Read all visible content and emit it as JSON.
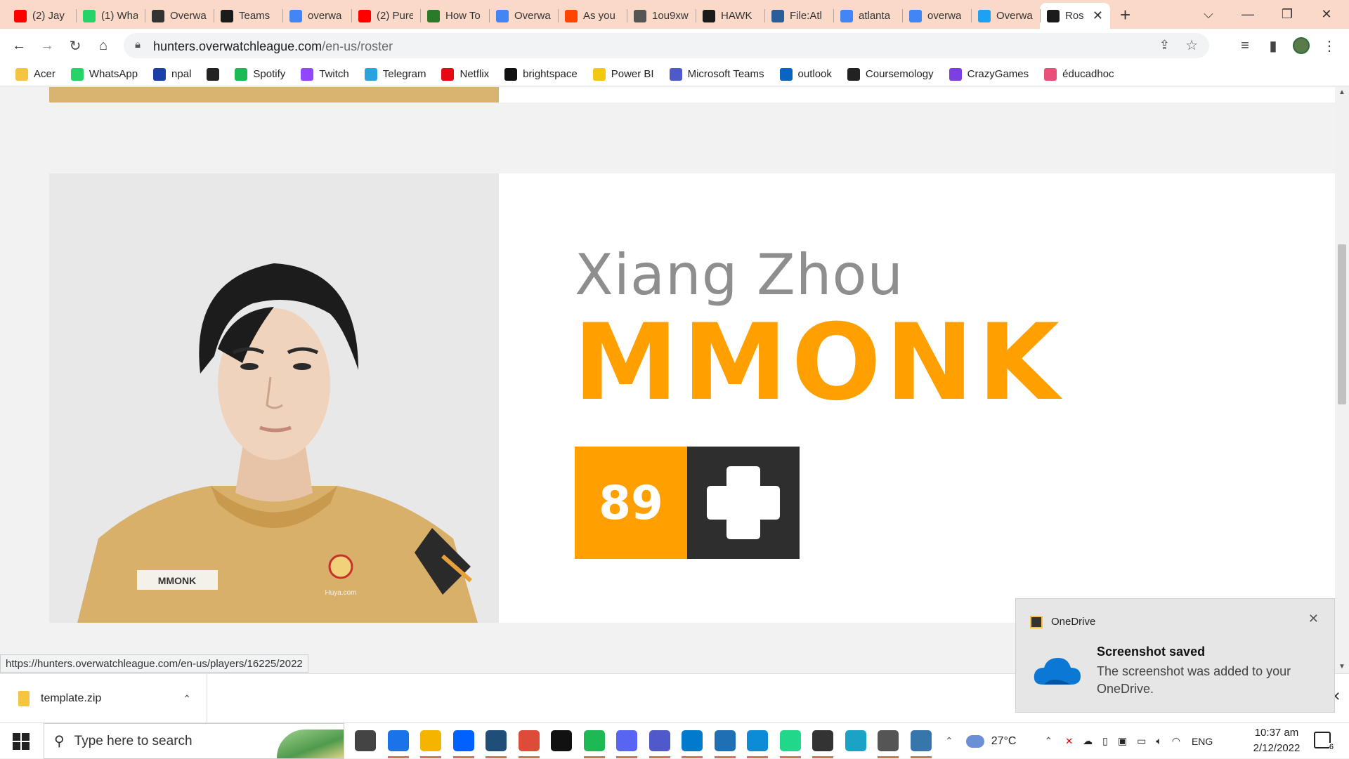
{
  "browser": {
    "tabs": [
      {
        "label": "(2) Jay",
        "icon": "youtube-icon",
        "color": "#ff0000"
      },
      {
        "label": "(1) Wha",
        "icon": "whatsapp-icon",
        "color": "#25d366"
      },
      {
        "label": "Overwa",
        "icon": "overwatch-icon",
        "color": "#333333"
      },
      {
        "label": "Teams",
        "icon": "atlanta-reign-icon",
        "color": "#1b1b1b"
      },
      {
        "label": "overwa",
        "icon": "google-icon",
        "color": "#4285f4"
      },
      {
        "label": "(2) Pure",
        "icon": "youtube-icon",
        "color": "#ff0000"
      },
      {
        "label": "How To",
        "icon": "wikihow-icon",
        "color": "#2a7a2a"
      },
      {
        "label": "Overwa",
        "icon": "google-icon",
        "color": "#4285f4"
      },
      {
        "label": "As you",
        "icon": "reddit-icon",
        "color": "#ff4500"
      },
      {
        "label": "1ou9xw",
        "icon": "globe-icon",
        "color": "#555555"
      },
      {
        "label": "HAWK",
        "icon": "atlanta-reign-icon",
        "color": "#1b1b1b"
      },
      {
        "label": "File:Atl",
        "icon": "wikimedia-icon",
        "color": "#2a5e9a"
      },
      {
        "label": "atlanta",
        "icon": "google-icon",
        "color": "#4285f4"
      },
      {
        "label": "overwa",
        "icon": "google-icon",
        "color": "#4285f4"
      },
      {
        "label": "Overwa",
        "icon": "twitter-icon",
        "color": "#1da1f2"
      },
      {
        "label": "Ros",
        "icon": "atlanta-reign-icon",
        "color": "#1b1b1b"
      }
    ],
    "new_tab_label": "+",
    "url_domain": "hunters.overwatchleague.com",
    "url_path": "/en-us/roster",
    "bookmarks": [
      {
        "label": "Acer",
        "icon": "folder-icon",
        "color": "#f5c542"
      },
      {
        "label": "WhatsApp",
        "icon": "whatsapp-icon",
        "color": "#25d366"
      },
      {
        "label": "npal",
        "icon": "npal-icon",
        "color": "#1a3fa8"
      },
      {
        "label": "",
        "icon": "globe-icon",
        "color": "#222222"
      },
      {
        "label": "Spotify",
        "icon": "spotify-icon",
        "color": "#1db954"
      },
      {
        "label": "Twitch",
        "icon": "twitch-icon",
        "color": "#9146ff"
      },
      {
        "label": "Telegram",
        "icon": "telegram-icon",
        "color": "#2aa3df"
      },
      {
        "label": "Netflix",
        "icon": "netflix-icon",
        "color": "#e50914"
      },
      {
        "label": "brightspace",
        "icon": "np-icon",
        "color": "#111111"
      },
      {
        "label": "Power BI",
        "icon": "powerbi-icon",
        "color": "#f2c811"
      },
      {
        "label": "Microsoft Teams",
        "icon": "teams-icon",
        "color": "#5059c9"
      },
      {
        "label": "outlook",
        "icon": "outlook-icon",
        "color": "#0a64c2"
      },
      {
        "label": "Coursemology",
        "icon": "coursemology-icon",
        "color": "#222222"
      },
      {
        "label": "CrazyGames",
        "icon": "crazygames-icon",
        "color": "#7b3fe4"
      },
      {
        "label": "éducadhoc",
        "icon": "educadhoc-icon",
        "color": "#e8507a"
      }
    ]
  },
  "player": {
    "real_name": "Xiang Zhou",
    "gamertag": "MMONK",
    "jersey_number": "89",
    "role_icon": "support-plus-icon",
    "shirt_nametag": "MMONK",
    "shirt_sponsor": "Huya.com",
    "accent_color": "#ff9f00",
    "dark_color": "#2e2e2e"
  },
  "status_bar": {
    "link": "https://hunters.overwatchleague.com/en-us/players/16225/2022"
  },
  "downloads": {
    "file_name": "template.zip"
  },
  "toast": {
    "app": "OneDrive",
    "title": "Screenshot saved",
    "body": "The screenshot was added to your OneDrive."
  },
  "taskbar": {
    "search_placeholder": "Type here to search",
    "weather": "27°C",
    "language": "ENG",
    "time": "10:37 am",
    "date": "2/12/2022",
    "notification_count": "6",
    "apps": [
      {
        "name": "task-view-icon",
        "color": "#444444"
      },
      {
        "name": "mail-icon",
        "color": "#1a73e8"
      },
      {
        "name": "file-explorer-icon",
        "color": "#f4b400"
      },
      {
        "name": "dropbox-icon",
        "color": "#0061fe"
      },
      {
        "name": "pyzo-icon",
        "color": "#1f4e79"
      },
      {
        "name": "chrome-icon",
        "color": "#dd4b39"
      },
      {
        "name": "netflix-icon",
        "color": "#111111"
      },
      {
        "name": "spotify-icon",
        "color": "#1db954"
      },
      {
        "name": "discord-icon",
        "color": "#5865f2"
      },
      {
        "name": "teams-icon",
        "color": "#5059c9"
      },
      {
        "name": "vscode-icon",
        "color": "#007acc"
      },
      {
        "name": "photos-icon",
        "color": "#1f6fb5"
      },
      {
        "name": "edge-icon",
        "color": "#0c8bd6"
      },
      {
        "name": "pycharm-icon",
        "color": "#21d789"
      },
      {
        "name": "unity-icon",
        "color": "#333333"
      },
      {
        "name": "maya-icon",
        "color": "#1aa3c4"
      },
      {
        "name": "unity-hub-icon",
        "color": "#555555"
      },
      {
        "name": "python-icon",
        "color": "#3776ab"
      }
    ]
  }
}
